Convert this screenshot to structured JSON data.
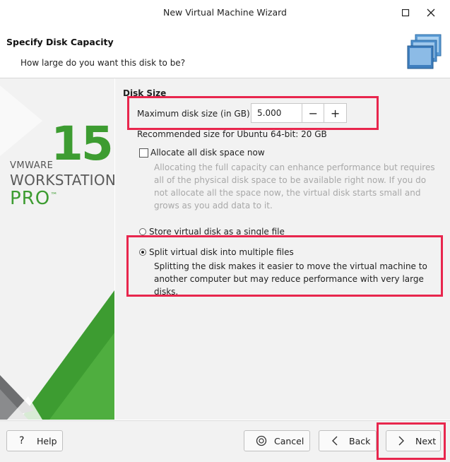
{
  "window": {
    "title": "New Virtual Machine Wizard"
  },
  "header": {
    "title": "Specify Disk Capacity",
    "subtitle": "How large do you want this disk to be?"
  },
  "brand": {
    "vmware": "VMWARE",
    "version": "15",
    "workstation": "WORKSTATION",
    "edition": "PRO",
    "trademark": "™",
    "colors": {
      "green": "#3d9c31",
      "gray": "#6d6e70"
    }
  },
  "disk": {
    "section_label": "Disk Size",
    "max_size_label": "Maximum disk size (in GB):",
    "max_size_value": "5.000",
    "decrement": "−",
    "increment": "+",
    "recommended": "Recommended size for Ubuntu 64-bit: 20 GB",
    "allocate_label": "Allocate all disk space now",
    "allocate_checked": false,
    "allocate_desc": "Allocating the full capacity can enhance performance but requires all of the physical disk space to be available right now. If you do not allocate all the space now, the virtual disk starts small and grows as you add data to it.",
    "single_file_label": "Store virtual disk as a single file",
    "split_label": "Split virtual disk into multiple files",
    "split_desc": "Splitting the disk makes it easier to move the virtual machine to another computer but may reduce performance with very large disks.",
    "selected_option": "split"
  },
  "footer": {
    "help": "Help",
    "cancel": "Cancel",
    "back": "Back",
    "next": "Next"
  },
  "colors": {
    "highlight": "#e8264d",
    "panel_bg": "#f2f2f2"
  }
}
